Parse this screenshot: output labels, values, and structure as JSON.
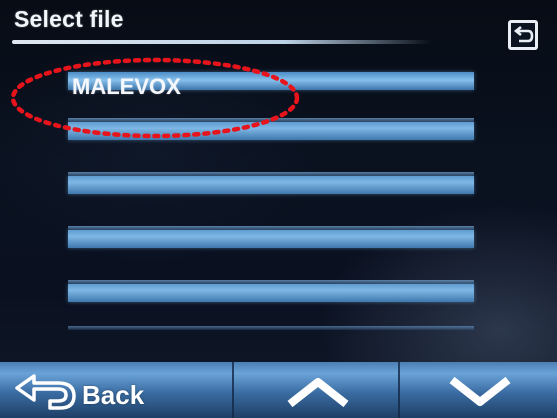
{
  "header": {
    "title": "Select file",
    "back_icon": "return-arrow-icon"
  },
  "file_list": {
    "items": [
      {
        "label": "MALEVOX",
        "selected": true
      },
      {
        "label": ""
      },
      {
        "label": ""
      },
      {
        "label": ""
      },
      {
        "label": ""
      }
    ]
  },
  "footer": {
    "back_label": "Back",
    "back_icon": "back-arrow-icon",
    "up_icon": "chevron-up-icon",
    "down_icon": "chevron-down-icon"
  },
  "colors": {
    "accent_blue": "#6aa3d8",
    "annotation_red": "#e8141c",
    "text": "#f4f7fb"
  }
}
